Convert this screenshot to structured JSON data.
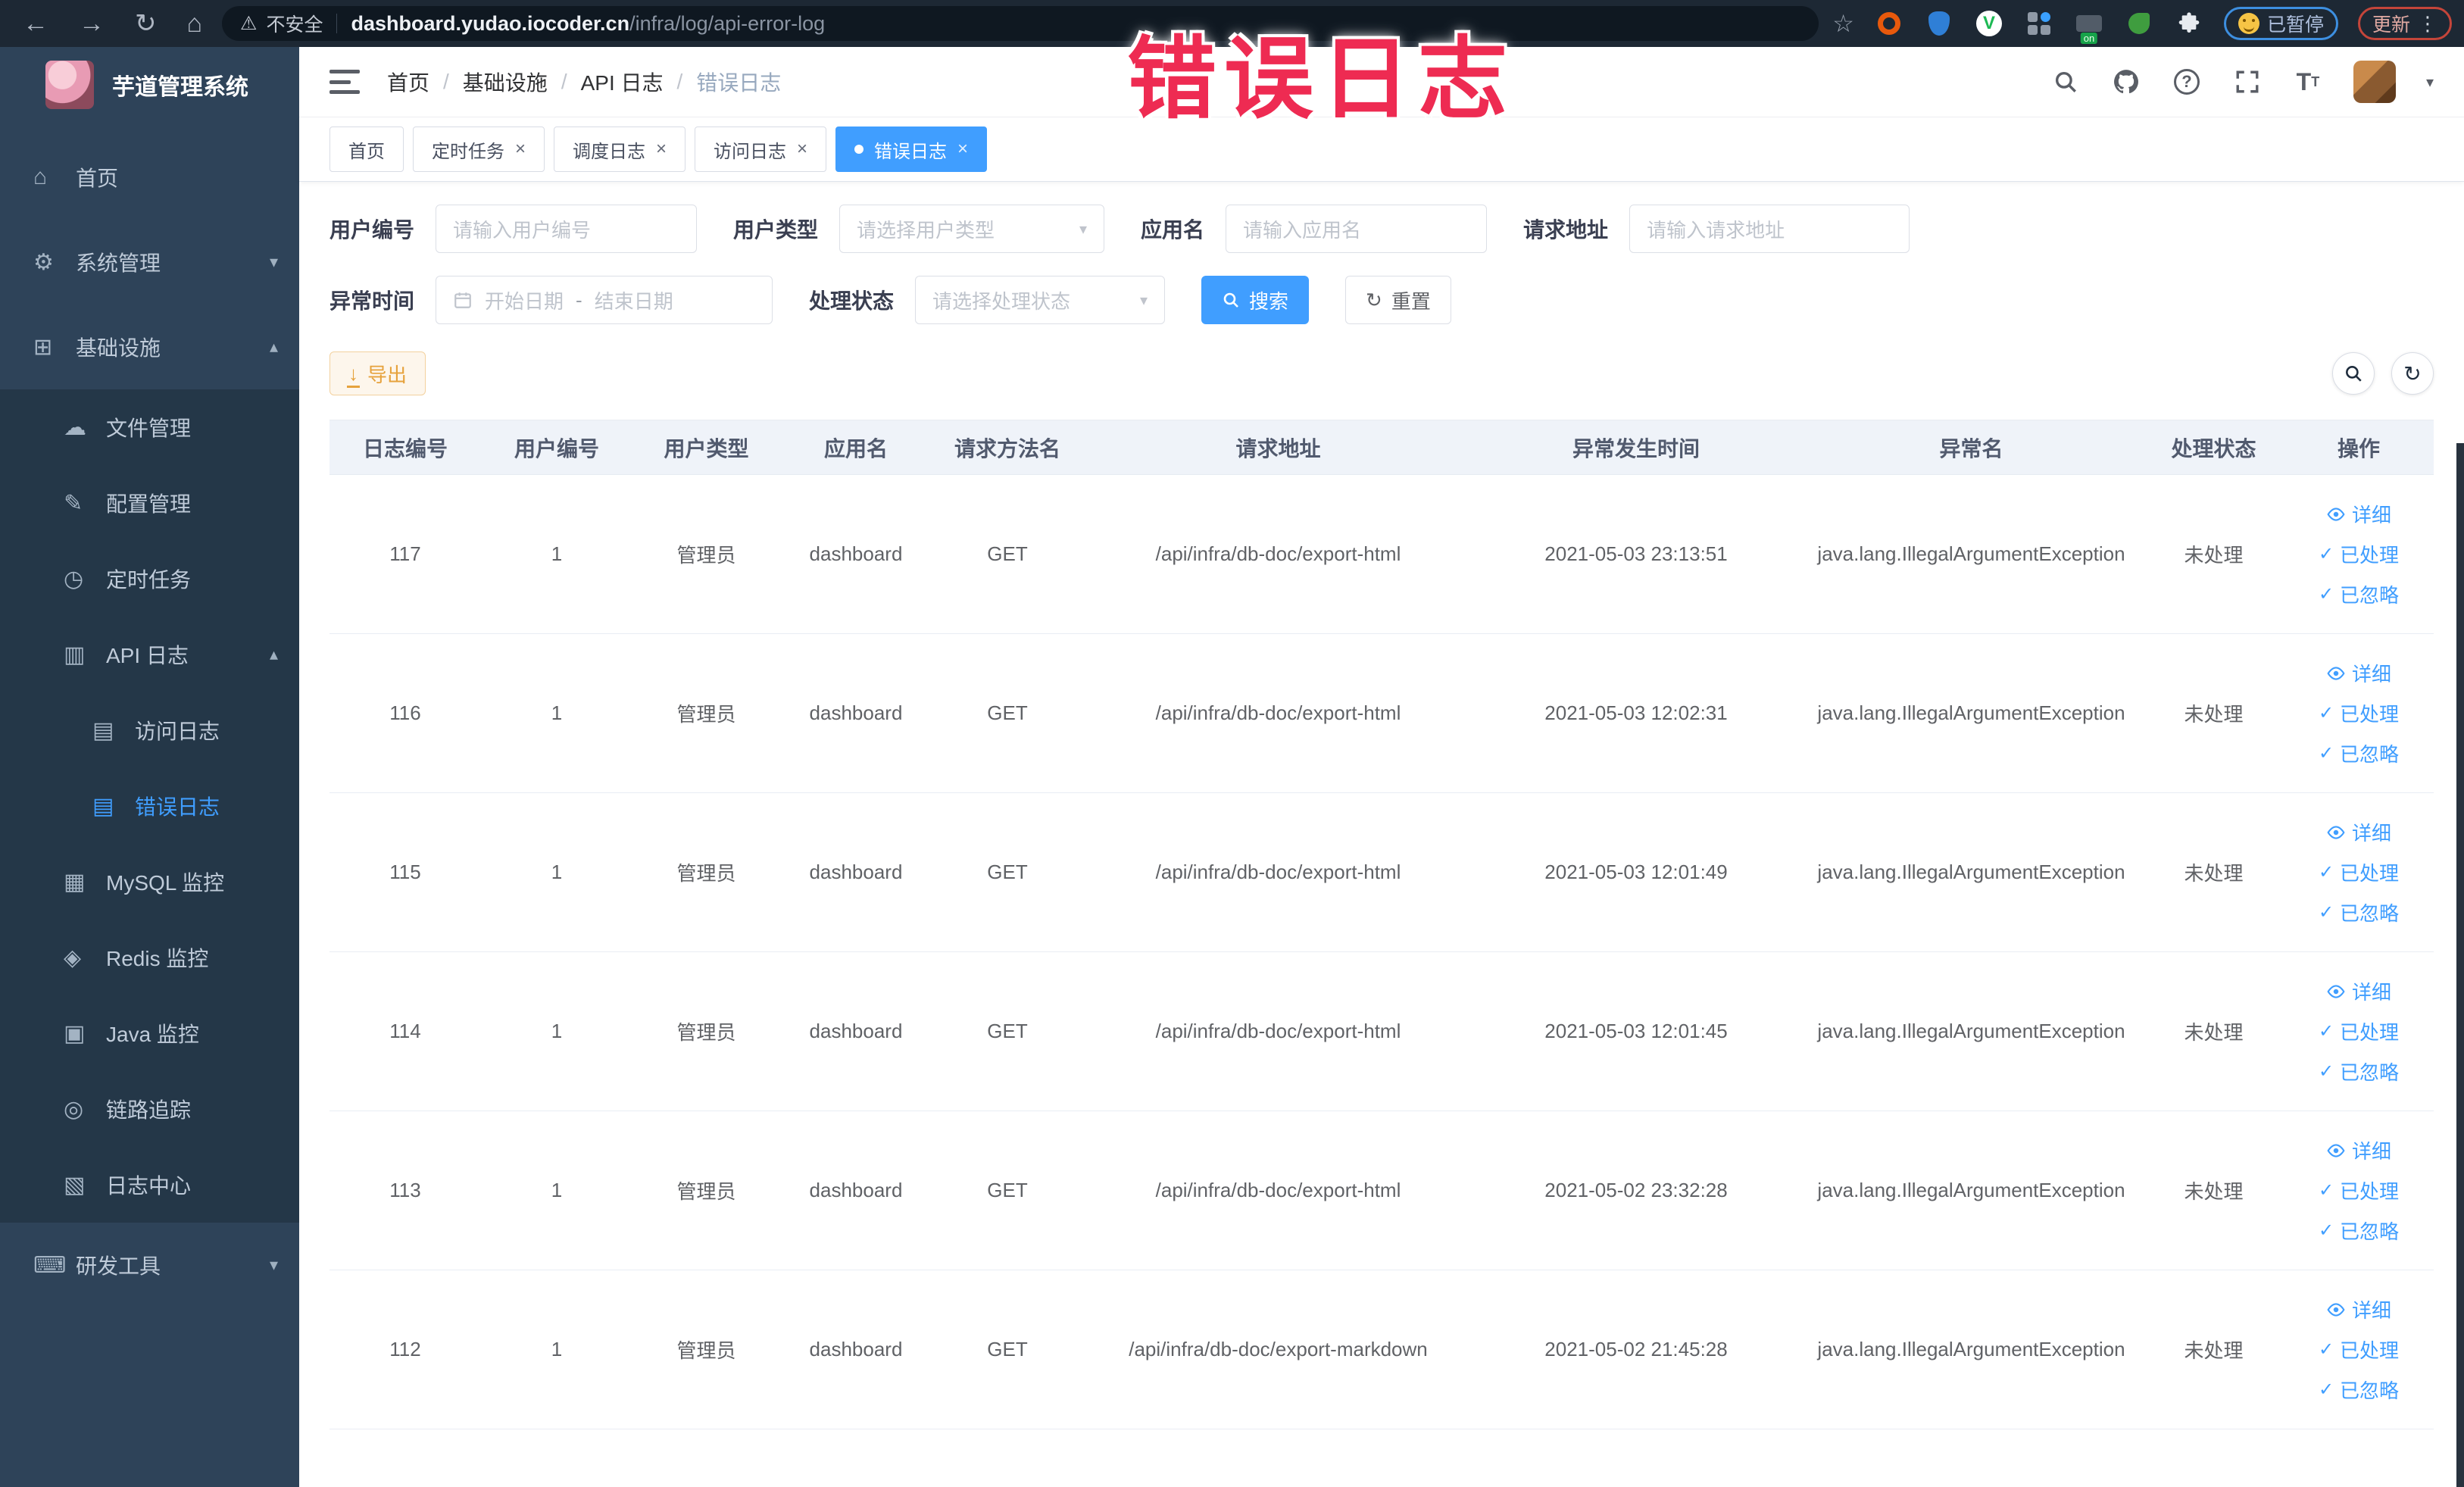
{
  "colors": {
    "accent": "#409eff",
    "warning": "#e6a23c",
    "annotation": "#ee2b52",
    "sidebar_bg": "#2e4359",
    "submenu_bg": "#243748",
    "chrome_bg": "#1d2834"
  },
  "browser": {
    "security_label": "不安全",
    "url_host": "dashboard.yudao.iocoder.cn",
    "url_path": "/infra/log/api-error-log",
    "paused_badge": "已暂停",
    "update_label": "更新"
  },
  "annotation": {
    "text": "错误日志"
  },
  "sidebar": {
    "title": "芋道管理系统",
    "items": [
      {
        "label": "首页",
        "icon": "home-icon",
        "level": 1
      },
      {
        "label": "系统管理",
        "icon": "gear-icon",
        "level": 1,
        "chevron": "down"
      },
      {
        "label": "基础设施",
        "icon": "infrastructure-icon",
        "level": 1,
        "chevron": "up"
      },
      {
        "label": "文件管理",
        "icon": "cloud-upload-icon",
        "level": 2,
        "group": true
      },
      {
        "label": "配置管理",
        "icon": "edit-icon",
        "level": 2,
        "group": true
      },
      {
        "label": "定时任务",
        "icon": "timer-icon",
        "level": 2,
        "group": true
      },
      {
        "label": "API 日志",
        "icon": "api-log-icon",
        "level": 2,
        "group": true,
        "chevron": "up"
      },
      {
        "label": "访问日志",
        "icon": "access-log-icon",
        "level": 3,
        "group": true
      },
      {
        "label": "错误日志",
        "icon": "error-log-icon",
        "level": 3,
        "group": true,
        "active": true
      },
      {
        "label": "MySQL 监控",
        "icon": "mysql-icon",
        "level": 2,
        "group": true
      },
      {
        "label": "Redis 监控",
        "icon": "redis-icon",
        "level": 2,
        "group": true
      },
      {
        "label": "Java 监控",
        "icon": "java-icon",
        "level": 2,
        "group": true
      },
      {
        "label": "链路追踪",
        "icon": "trace-eye-icon",
        "level": 2,
        "group": true
      },
      {
        "label": "日志中心",
        "icon": "log-center-icon",
        "level": 2,
        "group": true
      },
      {
        "label": "研发工具",
        "icon": "devtools-icon",
        "level": 1,
        "chevron": "down"
      }
    ]
  },
  "header": {
    "breadcrumb": [
      "首页",
      "基础设施",
      "API 日志",
      "错误日志"
    ],
    "icons": [
      "search-icon",
      "github-icon",
      "help-icon",
      "fullscreen-icon",
      "font-size-icon",
      "avatar",
      "chevron-down-icon"
    ]
  },
  "tabs": [
    {
      "label": "首页",
      "closable": false,
      "active": false
    },
    {
      "label": "定时任务",
      "closable": true,
      "active": false
    },
    {
      "label": "调度日志",
      "closable": true,
      "active": false
    },
    {
      "label": "访问日志",
      "closable": true,
      "active": false
    },
    {
      "label": "错误日志",
      "closable": true,
      "active": true
    }
  ],
  "filters": {
    "user_id": {
      "label": "用户编号",
      "placeholder": "请输入用户编号"
    },
    "user_type": {
      "label": "用户类型",
      "placeholder": "请选择用户类型"
    },
    "app_name": {
      "label": "应用名",
      "placeholder": "请输入应用名"
    },
    "request_url": {
      "label": "请求地址",
      "placeholder": "请输入请求地址"
    },
    "exception_time": {
      "label": "异常时间",
      "start_placeholder": "开始日期",
      "separator": "-",
      "end_placeholder": "结束日期"
    },
    "process_status": {
      "label": "处理状态",
      "placeholder": "请选择处理状态"
    },
    "search_button": "搜索",
    "reset_button": "重置"
  },
  "toolbar": {
    "export_button": "导出"
  },
  "table": {
    "columns": [
      "日志编号",
      "用户编号",
      "用户类型",
      "应用名",
      "请求方法名",
      "请求地址",
      "异常发生时间",
      "异常名",
      "处理状态",
      "操作"
    ],
    "actions": [
      "详细",
      "已处理",
      "已忽略"
    ],
    "rows": [
      {
        "id": "117",
        "user_id": "1",
        "user_type": "管理员",
        "app": "dashboard",
        "method": "GET",
        "url": "/api/infra/db-doc/export-html",
        "time": "2021-05-03 23:13:51",
        "exception": "java.lang.IllegalArgumentException",
        "status": "未处理"
      },
      {
        "id": "116",
        "user_id": "1",
        "user_type": "管理员",
        "app": "dashboard",
        "method": "GET",
        "url": "/api/infra/db-doc/export-html",
        "time": "2021-05-03 12:02:31",
        "exception": "java.lang.IllegalArgumentException",
        "status": "未处理"
      },
      {
        "id": "115",
        "user_id": "1",
        "user_type": "管理员",
        "app": "dashboard",
        "method": "GET",
        "url": "/api/infra/db-doc/export-html",
        "time": "2021-05-03 12:01:49",
        "exception": "java.lang.IllegalArgumentException",
        "status": "未处理"
      },
      {
        "id": "114",
        "user_id": "1",
        "user_type": "管理员",
        "app": "dashboard",
        "method": "GET",
        "url": "/api/infra/db-doc/export-html",
        "time": "2021-05-03 12:01:45",
        "exception": "java.lang.IllegalArgumentException",
        "status": "未处理"
      },
      {
        "id": "113",
        "user_id": "1",
        "user_type": "管理员",
        "app": "dashboard",
        "method": "GET",
        "url": "/api/infra/db-doc/export-html",
        "time": "2021-05-02 23:32:28",
        "exception": "java.lang.IllegalArgumentException",
        "status": "未处理"
      },
      {
        "id": "112",
        "user_id": "1",
        "user_type": "管理员",
        "app": "dashboard",
        "method": "GET",
        "url": "/api/infra/db-doc/export-markdown",
        "time": "2021-05-02 21:45:28",
        "exception": "java.lang.IllegalArgumentException",
        "status": "未处理"
      }
    ]
  }
}
